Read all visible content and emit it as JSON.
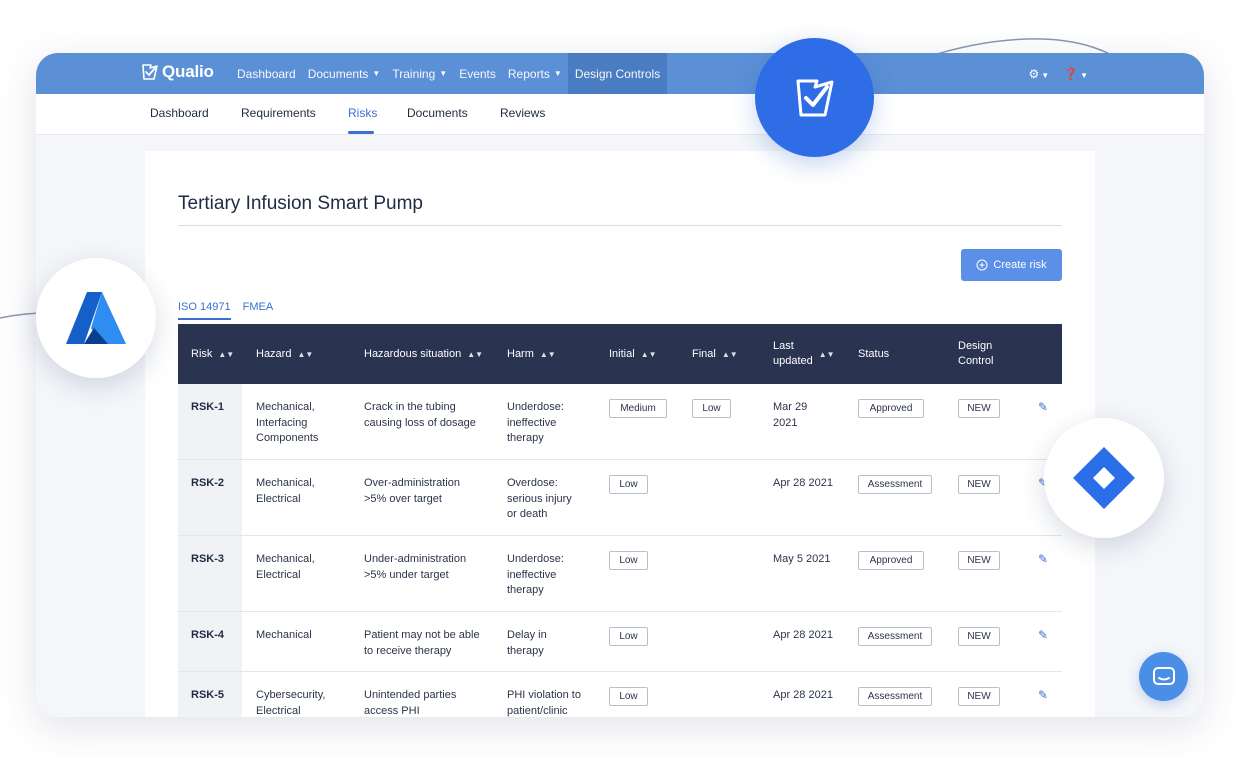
{
  "topbar": {
    "brand": "Qualio",
    "nav": [
      {
        "label": "Dashboard",
        "caret": false
      },
      {
        "label": "Documents",
        "caret": true
      },
      {
        "label": "Training",
        "caret": true
      },
      {
        "label": "Events",
        "caret": false
      },
      {
        "label": "Reports",
        "caret": true
      },
      {
        "label": "Design Controls",
        "caret": false,
        "active": true
      }
    ],
    "settings_icon": "gear-icon",
    "help_icon": "help-icon"
  },
  "subnav": {
    "tabs": [
      "Dashboard",
      "Requirements",
      "Risks",
      "Documents",
      "Reviews"
    ],
    "active": "Risks"
  },
  "page": {
    "title": "Tertiary Infusion Smart Pump",
    "create_button": "Create risk",
    "standards": [
      "ISO 14971",
      "FMEA"
    ],
    "active_standard": "ISO 14971"
  },
  "table": {
    "headers": {
      "risk": "Risk",
      "hazard": "Hazard",
      "situation": "Hazardous situation",
      "harm": "Harm",
      "initial": "Initial",
      "final": "Final",
      "updated_1": "Last",
      "updated_2": "updated",
      "status": "Status",
      "design_1": "Design",
      "design_2": "Control"
    },
    "rows": [
      {
        "risk": "RSK-1",
        "hazard": [
          "Mechanical,",
          "Interfacing",
          "Components"
        ],
        "situation": [
          "Crack in the tubing",
          "causing loss of dosage"
        ],
        "harm": [
          "Underdose:",
          "ineffective",
          "therapy"
        ],
        "initial": "Medium",
        "final": "Low",
        "updated": [
          "Mar 29",
          "2021"
        ],
        "status": "Approved",
        "design": "NEW"
      },
      {
        "risk": "RSK-2",
        "hazard": [
          "Mechanical,",
          "Electrical"
        ],
        "situation": [
          "Over-administration",
          ">5% over target"
        ],
        "harm": [
          "Overdose:",
          "serious injury",
          "or death"
        ],
        "initial": "Low",
        "final": "",
        "updated": [
          "Apr 28 2021"
        ],
        "status": "Assessment",
        "design": "NEW"
      },
      {
        "risk": "RSK-3",
        "hazard": [
          "Mechanical,",
          "Electrical"
        ],
        "situation": [
          "Under-administration",
          ">5% under target"
        ],
        "harm": [
          "Underdose:",
          "ineffective",
          "therapy"
        ],
        "initial": "Low",
        "final": "",
        "updated": [
          "May 5 2021"
        ],
        "status": "Approved",
        "design": "NEW"
      },
      {
        "risk": "RSK-4",
        "hazard": [
          "Mechanical"
        ],
        "situation": [
          "Patient may not be able",
          "to receive therapy"
        ],
        "harm": [
          "Delay in",
          "therapy"
        ],
        "initial": "Low",
        "final": "",
        "updated": [
          "Apr 28 2021"
        ],
        "status": "Assessment",
        "design": "NEW"
      },
      {
        "risk": "RSK-5",
        "hazard": [
          "Cybersecurity,",
          "Electrical"
        ],
        "situation": [
          "Unintended parties",
          "access PHI"
        ],
        "harm": [
          "PHI violation to",
          "patient/clinic"
        ],
        "initial": "Low",
        "final": "",
        "updated": [
          "Apr 28 2021"
        ],
        "status": "Assessment",
        "design": "NEW"
      }
    ]
  },
  "integrations": {
    "left": "azure-logo",
    "top": "qualio-logo",
    "right": "jira-logo"
  },
  "colors": {
    "topbar": "#5b8fd6",
    "accent": "#3b6fd4",
    "table_header": "#2a3350",
    "button": "#5b8fe8"
  }
}
